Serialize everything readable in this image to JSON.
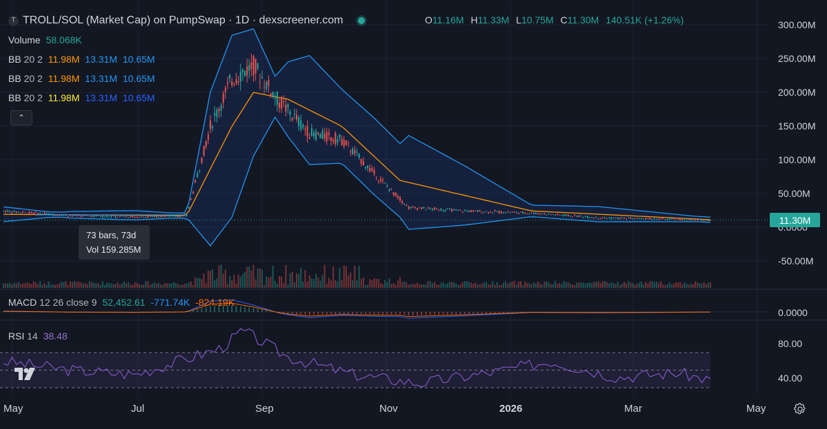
{
  "header": {
    "logo_letter": "T",
    "title": "TROLL/SOL (Market Cap) on PumpSwap · 1D · dexscreener.com",
    "ohlc": {
      "o_label": "O",
      "o": "11.16M",
      "h_label": "H",
      "h": "11.33M",
      "l_label": "L",
      "l": "10.75M",
      "c_label": "C",
      "c": "11.30M",
      "change": "140.51K (+1.26%)"
    }
  },
  "legend": {
    "volume_label": "Volume",
    "volume_value": "58.068K",
    "bb": [
      {
        "label": "BB",
        "params": "20 2",
        "basis": "11.98M",
        "upper": "13.31M",
        "lower": "10.65M",
        "basis_color": "#ff9800",
        "upper_color": "#2196f3",
        "lower_color": "#2196f3"
      },
      {
        "label": "BB",
        "params": "20 2",
        "basis": "11.98M",
        "upper": "13.31M",
        "lower": "10.65M",
        "basis_color": "#ff9800",
        "upper_color": "#2196f3",
        "lower_color": "#2196f3"
      },
      {
        "label": "BB",
        "params": "20 2",
        "basis": "11.98M",
        "upper": "13.31M",
        "lower": "10.65M",
        "basis_color": "#ffeb3b",
        "upper_color": "#2962ff",
        "lower_color": "#2962ff"
      }
    ],
    "collapse_icon": "chevron-up-icon",
    "macd_label": "MACD",
    "macd_params": "12 26 close 9",
    "macd_hist": "52,452.61",
    "macd_line": "-771.74K",
    "macd_signal": "-824.19K",
    "rsi_label": "RSI",
    "rsi_params": "14",
    "rsi_value": "38.48"
  },
  "tooltip": {
    "bars": "73 bars, 73d",
    "vol": "Vol 159.285M"
  },
  "price_tag": "11.30M",
  "colors": {
    "background": "#131722",
    "up": "#26a69a",
    "down": "#ef5350",
    "bb_band": "#2962ff",
    "bb_basis": "#ff9800",
    "macd_line": "#2962ff",
    "macd_signal": "#ff6d00",
    "rsi": "#7e57c2"
  },
  "chart_data": [
    {
      "type": "line",
      "title": "TROLL/SOL (Market Cap) on PumpSwap · 1D · dexscreener.com",
      "yaxis_ticks": [
        "300.00M",
        "250.00M",
        "200.00M",
        "150.00M",
        "100.00M",
        "50.00M",
        "0.0000",
        "-50.00M"
      ],
      "ylim": [
        -60,
        300
      ],
      "xaxis_ticks": [
        "May",
        "Jul",
        "Sep",
        "Nov",
        "2026",
        "Mar",
        "May"
      ],
      "series": [
        {
          "name": "",
          "x": [
            "2025-05-01",
            "2025-06-01",
            "2025-07-01",
            "2025-07-25",
            "2025-08-05",
            "2025-08-15",
            "2025-08-25",
            "2025-09-05",
            "2025-09-20",
            "2025-10-05",
            "2025-10-20",
            "2025-11-05",
            "2025-12-01",
            "2026-01-01",
            "2026-02-01",
            "2026-03-01",
            "2026-03-25"
          ],
          "values": [
            25,
            18,
            16,
            18,
            150,
            220,
            240,
            190,
            140,
            130,
            80,
            30,
            25,
            22,
            15,
            13,
            11.3
          ]
        },
        {
          "name": "",
          "x": [
            "2025-05-01",
            "2025-07-25",
            "2025-08-15",
            "2025-08-25",
            "2025-09-10",
            "2025-10-05",
            "2025-11-01",
            "2026-01-01",
            "2026-03-25"
          ],
          "values": [
            20,
            18,
            150,
            200,
            190,
            150,
            70,
            25,
            11.98
          ]
        }
      ]
    },
    {
      "type": "bar",
      "title": "",
      "series": [
        {
          "name": "",
          "values": [
            52452.61,
            -771740,
            -824190
          ]
        }
      ],
      "yaxis_ticks": [
        "0.0000"
      ]
    },
    {
      "type": "line",
      "title": "",
      "yaxis_ticks": [
        "80.00",
        "40.00"
      ],
      "ylim": [
        20,
        100
      ],
      "series": [
        {
          "name": "",
          "x": [
            "2025-05-01",
            "2025-06-01",
            "2025-07-01",
            "2025-08-10",
            "2025-08-20",
            "2025-09-10",
            "2025-10-10",
            "2025-11-10",
            "2025-12-15",
            "2026-01-10",
            "2026-02-10",
            "2026-03-10",
            "2026-03-25"
          ],
          "values": [
            60,
            50,
            45,
            75,
            95,
            65,
            45,
            35,
            48,
            60,
            42,
            47,
            38.48
          ]
        }
      ]
    }
  ]
}
